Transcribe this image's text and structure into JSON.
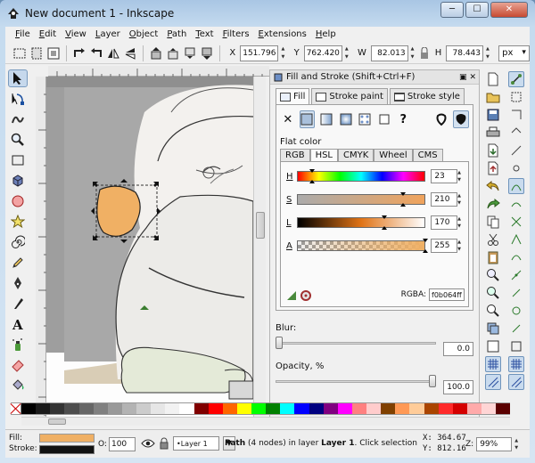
{
  "window": {
    "title": "New document 1 - Inkscape",
    "min_glyph": "─",
    "max_glyph": "☐",
    "close_glyph": "✕"
  },
  "menus": [
    "File",
    "Edit",
    "View",
    "Layer",
    "Object",
    "Path",
    "Text",
    "Filters",
    "Extensions",
    "Help"
  ],
  "toolbar": {
    "x_label": "X",
    "x_value": "151.796",
    "y_label": "Y",
    "y_value": "762.420",
    "w_label": "W",
    "w_value": "82.013",
    "h_label": "H",
    "h_value": "78.443",
    "unit": "px"
  },
  "fill_stroke": {
    "title": "Fill and Stroke (Shift+Ctrl+F)",
    "tabs": [
      "Fill",
      "Stroke paint",
      "Stroke style"
    ],
    "paint_none_glyph": "✕",
    "paint_unknown_glyph": "?",
    "flat_color_label": "Flat color",
    "color_tabs": [
      "RGB",
      "HSL",
      "CMYK",
      "Wheel",
      "CMS"
    ],
    "sliders": [
      {
        "label": "H",
        "value": "23",
        "level": 0.09
      },
      {
        "label": "S",
        "value": "210",
        "level": 0.82
      },
      {
        "label": "L",
        "value": "170",
        "level": 0.67
      },
      {
        "label": "A",
        "value": "255",
        "level": 1.0
      }
    ],
    "rgba_label": "RGBA:",
    "rgba_value": "f0b064ff",
    "blur_label": "Blur:",
    "blur_value": "0.0",
    "blur_level": 0.0,
    "opacity_label": "Opacity, %",
    "opacity_value": "100.0",
    "opacity_level": 1.0
  },
  "statusbar": {
    "fill_label": "Fill:",
    "stroke_label": "Stroke:",
    "fill_color": "#f0b064",
    "stroke_color": "#111111",
    "o_label": "O:",
    "opacity_value": "100",
    "layer_name": "•Layer 1",
    "message_bold": "Path",
    "message_rest": " (4 nodes) in layer ",
    "message_layer": "Layer 1",
    "message_tail": ". Click selection to toggle scale/rotation handles.",
    "x_coord": "X: 364.67",
    "y_coord": "Y: 812.16",
    "zoom_label": "Z:",
    "zoom_value": "99%"
  },
  "colors": {
    "selected_fill": "#f0b064",
    "palette": [
      "#000000",
      "#1a1a1a",
      "#333333",
      "#4d4d4d",
      "#666666",
      "#808080",
      "#999999",
      "#b3b3b3",
      "#cccccc",
      "#e6e6e6",
      "#f2f2f2",
      "#ffffff",
      "#800000",
      "#ff0000",
      "#ff6600",
      "#ffff00",
      "#00ff00",
      "#008000",
      "#00ffff",
      "#0000ff",
      "#000080",
      "#800080",
      "#ff00ff",
      "#ff8080",
      "#ffcccc",
      "#804000",
      "#ff9955",
      "#ffcc99",
      "#aa4400",
      "#ff2a2a",
      "#d40000",
      "#ffaaaa",
      "#ffd5d5",
      "#5a0000"
    ]
  }
}
